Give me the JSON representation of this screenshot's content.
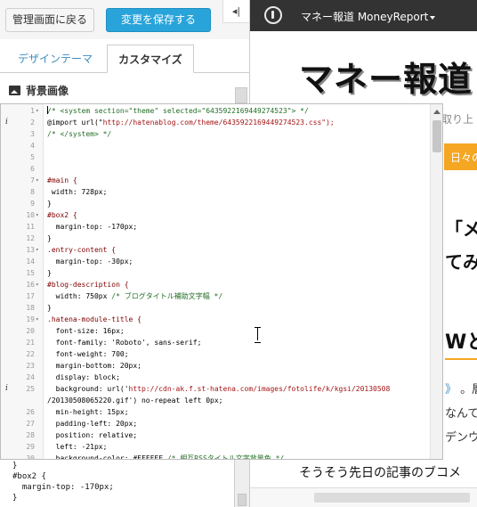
{
  "topbar": {
    "back_label": "管理画面に戻る",
    "save_label": "変更を保存する",
    "collapse_label": "◂|"
  },
  "tabs": {
    "design_theme": "デザインテーマ",
    "customize": "カスタマイズ"
  },
  "section": {
    "title": "背景画像"
  },
  "editor": {
    "lines": [
      {
        "n": "1",
        "fold": "▾",
        "info": "",
        "text": "/* <system section=\"theme\" selected=\"6435922169449274523\"> */"
      },
      {
        "n": "2",
        "fold": "",
        "info": "i",
        "text": "@import url(\"http://hatenablog.com/theme/6435922169449274523.css\");"
      },
      {
        "n": "3",
        "fold": "",
        "info": "",
        "text": "/* </system> */"
      },
      {
        "n": "4",
        "fold": "",
        "info": "",
        "text": ""
      },
      {
        "n": "5",
        "fold": "",
        "info": "",
        "text": ""
      },
      {
        "n": "6",
        "fold": "",
        "info": "",
        "text": ""
      },
      {
        "n": "7",
        "fold": "▾",
        "info": "",
        "text": "#main {"
      },
      {
        "n": "8",
        "fold": "",
        "info": "",
        "text": " width: 728px;"
      },
      {
        "n": "9",
        "fold": "",
        "info": "",
        "text": "}"
      },
      {
        "n": "10",
        "fold": "▾",
        "info": "",
        "text": "#box2 {"
      },
      {
        "n": "11",
        "fold": "",
        "info": "",
        "text": "  margin-top: -170px;"
      },
      {
        "n": "12",
        "fold": "",
        "info": "",
        "text": "}"
      },
      {
        "n": "13",
        "fold": "▾",
        "info": "",
        "text": ".entry-content {"
      },
      {
        "n": "14",
        "fold": "",
        "info": "",
        "text": "  margin-top: -30px;"
      },
      {
        "n": "15",
        "fold": "",
        "info": "",
        "text": "}"
      },
      {
        "n": "16",
        "fold": "▾",
        "info": "",
        "text": "#blog-description {"
      },
      {
        "n": "17",
        "fold": "",
        "info": "",
        "text": "  width: 750px /* ブログタイトル補助文字幅 */"
      },
      {
        "n": "18",
        "fold": "",
        "info": "",
        "text": "}"
      },
      {
        "n": "19",
        "fold": "▾",
        "info": "",
        "text": ".hatena-module-title {"
      },
      {
        "n": "20",
        "fold": "",
        "info": "",
        "text": "  font-size: 16px;"
      },
      {
        "n": "21",
        "fold": "",
        "info": "",
        "text": "  font-family: 'Roboto', sans-serif;"
      },
      {
        "n": "22",
        "fold": "",
        "info": "",
        "text": "  font-weight: 700;"
      },
      {
        "n": "23",
        "fold": "",
        "info": "",
        "text": "  margin-bottom: 20px;"
      },
      {
        "n": "24",
        "fold": "",
        "info": "",
        "text": "  display: block;"
      },
      {
        "n": "25",
        "fold": "",
        "info": "i",
        "text": "  background: url('http://cdn-ak.f.st-hatena.com/images/fotolife/k/kgsi/20130508"
      },
      {
        "n": "",
        "fold": "",
        "info": "",
        "text": "/20130508065220.gif') no-repeat left 0px;"
      },
      {
        "n": "26",
        "fold": "",
        "info": "",
        "text": "  min-height: 15px;"
      },
      {
        "n": "27",
        "fold": "",
        "info": "",
        "text": "  padding-left: 20px;"
      },
      {
        "n": "28",
        "fold": "",
        "info": "",
        "text": "  position: relative;"
      },
      {
        "n": "29",
        "fold": "",
        "info": "",
        "text": "  left: -21px;"
      },
      {
        "n": "30",
        "fold": "",
        "info": "",
        "text": "  background-color: #FFFFFF /* 相互RSSタイトル文字背景色 */"
      }
    ]
  },
  "bottom_textarea": {
    "lines": [
      "}",
      "#box2 {",
      "  margin-top: -170px;",
      "}"
    ]
  },
  "preview": {
    "header_title": "マネー報道 MoneyReport",
    "blog_title": "マネー報道",
    "blog_description": "取り上",
    "module_title": "日々の",
    "article_title_1": "「メ",
    "article_title_2": "てみた",
    "heading": "Wと",
    "body_link": "》",
    "body_1": "。層",
    "body_2": "なんて",
    "body_3": "デンウ",
    "bottom_text": "そうそう先日の記事のブコメ"
  },
  "colors": {
    "save_button": "#29a4da",
    "header_bg": "#333333",
    "accent_orange": "#f5a623",
    "link_blue": "#3b8dbd"
  }
}
